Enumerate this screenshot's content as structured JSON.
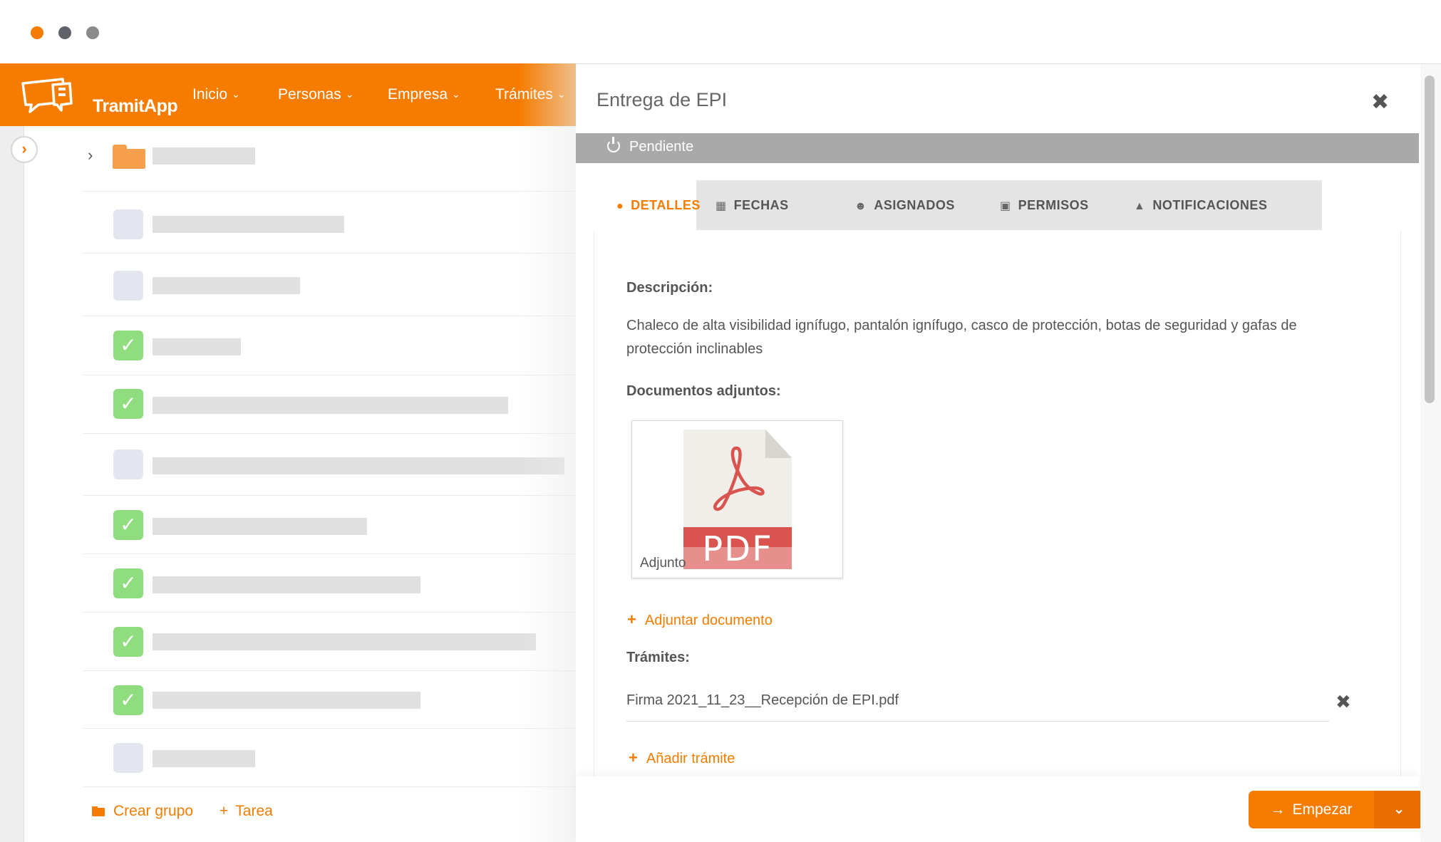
{
  "header": {
    "logo_text": "TramitApp",
    "nav": [
      {
        "label": "Inicio"
      },
      {
        "label": "Personas"
      },
      {
        "label": "Empresa"
      },
      {
        "label": "Trámites"
      }
    ]
  },
  "list": {
    "rows": [
      {
        "state": "empty"
      },
      {
        "state": "empty"
      },
      {
        "state": "checked"
      },
      {
        "state": "checked"
      },
      {
        "state": "empty"
      },
      {
        "state": "checked"
      },
      {
        "state": "checked"
      },
      {
        "state": "checked"
      },
      {
        "state": "checked"
      },
      {
        "state": "empty"
      }
    ],
    "actions": {
      "create_group": "Crear grupo",
      "task": "Tarea"
    }
  },
  "panel": {
    "title": "Entrega de EPI",
    "status": "Pendiente",
    "tabs": [
      {
        "label": "DETALLES",
        "icon": "info-circle-icon",
        "active": true
      },
      {
        "label": "FECHAS",
        "icon": "calendar-icon",
        "active": false
      },
      {
        "label": "ASIGNADOS",
        "icon": "users-icon",
        "active": false
      },
      {
        "label": "PERMISOS",
        "icon": "lock-icon",
        "active": false
      },
      {
        "label": "NOTIFICACIONES",
        "icon": "bell-icon",
        "active": false
      }
    ],
    "description_label": "Descripción:",
    "description": "Chaleco de alta visibilidad ignífugo, pantalón ignífugo, casco de protección, botas de seguridad y gafas de protección inclinables",
    "documents_label": "Documentos adjuntos:",
    "attachment": {
      "name": "Adjunto",
      "badge": "PDF"
    },
    "attach_link": "Adjuntar documento",
    "tramites_label": "Trámites:",
    "tramite_file": "Firma 2021_11_23__Recepción de EPI.pdf",
    "add_tramite_link": "Añadir trámite",
    "start_button": "Empezar"
  },
  "colors": {
    "accent": "#f57c00",
    "status_bar": "#a9a9a9",
    "check_green": "#8fdd7f",
    "pdf_red": "#d9534f"
  }
}
